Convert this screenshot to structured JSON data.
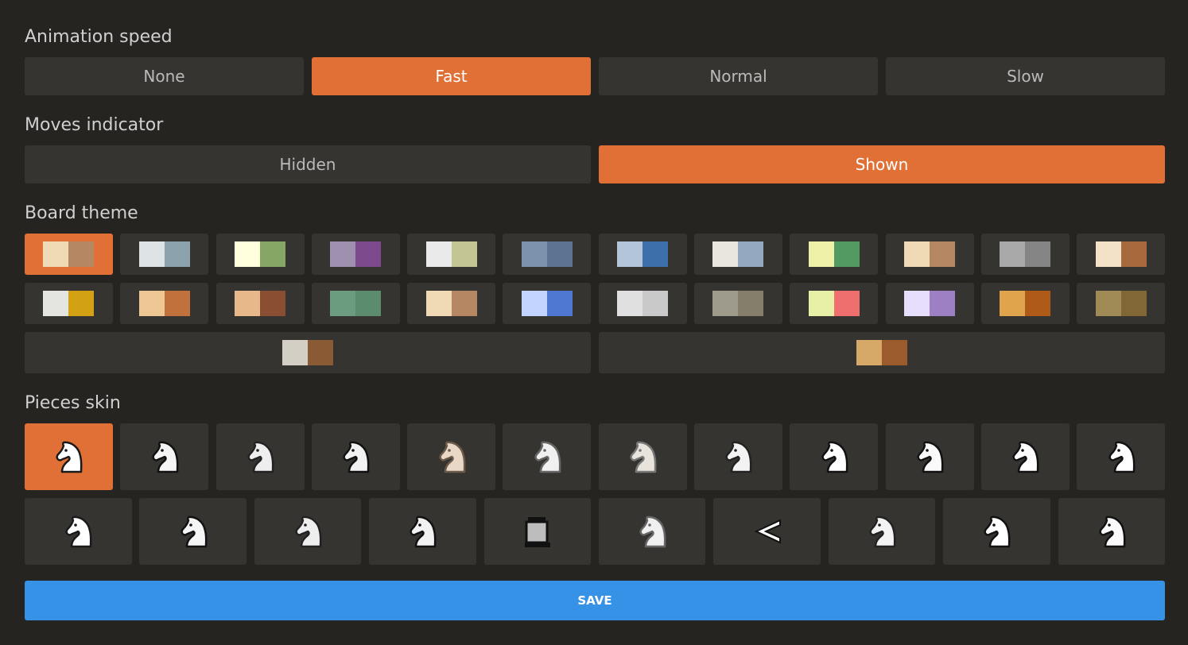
{
  "animation": {
    "title": "Animation speed",
    "options": [
      "None",
      "Fast",
      "Normal",
      "Slow"
    ],
    "selected": "Fast"
  },
  "moves": {
    "title": "Moves indicator",
    "options": [
      "Hidden",
      "Shown"
    ],
    "selected": "Shown"
  },
  "board": {
    "title": "Board theme",
    "selected_index": 0,
    "row1": [
      [
        "#f0d9b5",
        "#b58863"
      ],
      [
        "#dee3e6",
        "#8ca2ad"
      ],
      [
        "#ffffdd",
        "#86a666"
      ],
      [
        "#9f90b0",
        "#7d4a8d"
      ],
      [
        "#eaeaea",
        "#c3c595"
      ],
      [
        "#7b93ad",
        "#5e7391"
      ],
      [
        "#b3c5d8",
        "#3d6fab"
      ],
      [
        "#e9e6dd",
        "#94a8c0"
      ],
      [
        "#eef0a8",
        "#529a62"
      ],
      [
        "#f0d9b5",
        "#b58863"
      ],
      [
        "#a8a8a8",
        "#858585"
      ],
      [
        "#f4e2c8",
        "#a86a3d"
      ]
    ],
    "row2": [
      [
        "#e4e4e0",
        "#d3a114"
      ],
      [
        "#eec795",
        "#c0713c"
      ],
      [
        "#e6b88a",
        "#8a4f33"
      ],
      [
        "#6b9c7f",
        "#5a8c6d"
      ],
      [
        "#f0d9b5",
        "#b58863"
      ],
      [
        "#c2d4ff",
        "#4f78d2"
      ],
      [
        "#e0e0e0",
        "#c9c9c9"
      ],
      [
        "#9e9a8c",
        "#857e6a"
      ],
      [
        "#e8f0a8",
        "#ef6e6e"
      ],
      [
        "#e6defa",
        "#9d7fc4"
      ],
      [
        "#e0a44d",
        "#b05a1a"
      ],
      [
        "#a08a55",
        "#806735"
      ]
    ],
    "row3": [
      [
        "#d4cfc5",
        "#8a5a34"
      ],
      [
        "#d6a968",
        "#9b5b2c"
      ]
    ]
  },
  "pieces": {
    "title": "Pieces skin",
    "selected_index": 0,
    "row1_icons": [
      "knight-icon-cburnett",
      "knight-icon-merida",
      "knight-icon-alpha",
      "knight-icon-pirouetti",
      "knight-icon-chessnut",
      "knight-icon-chess7",
      "knight-icon-reillycraig",
      "knight-icon-companion",
      "knight-icon-riohacha",
      "knight-icon-kosal",
      "knight-icon-leipzig",
      "knight-icon-fantasy"
    ],
    "row2_icons": [
      "knight-icon-spatial",
      "knight-icon-california",
      "knight-icon-pixel-cardinal",
      "knight-icon-maestro",
      "knight-icon-pixel",
      "knight-icon-dubrovny",
      "knight-icon-shapes",
      "knight-icon-horsey",
      "knight-icon-governor",
      "knight-icon-staunty"
    ]
  },
  "save_label": "SAVE",
  "colors": {
    "accent": "#e07035",
    "tile": "#363431",
    "background": "#262421",
    "save": "#3692e7"
  }
}
